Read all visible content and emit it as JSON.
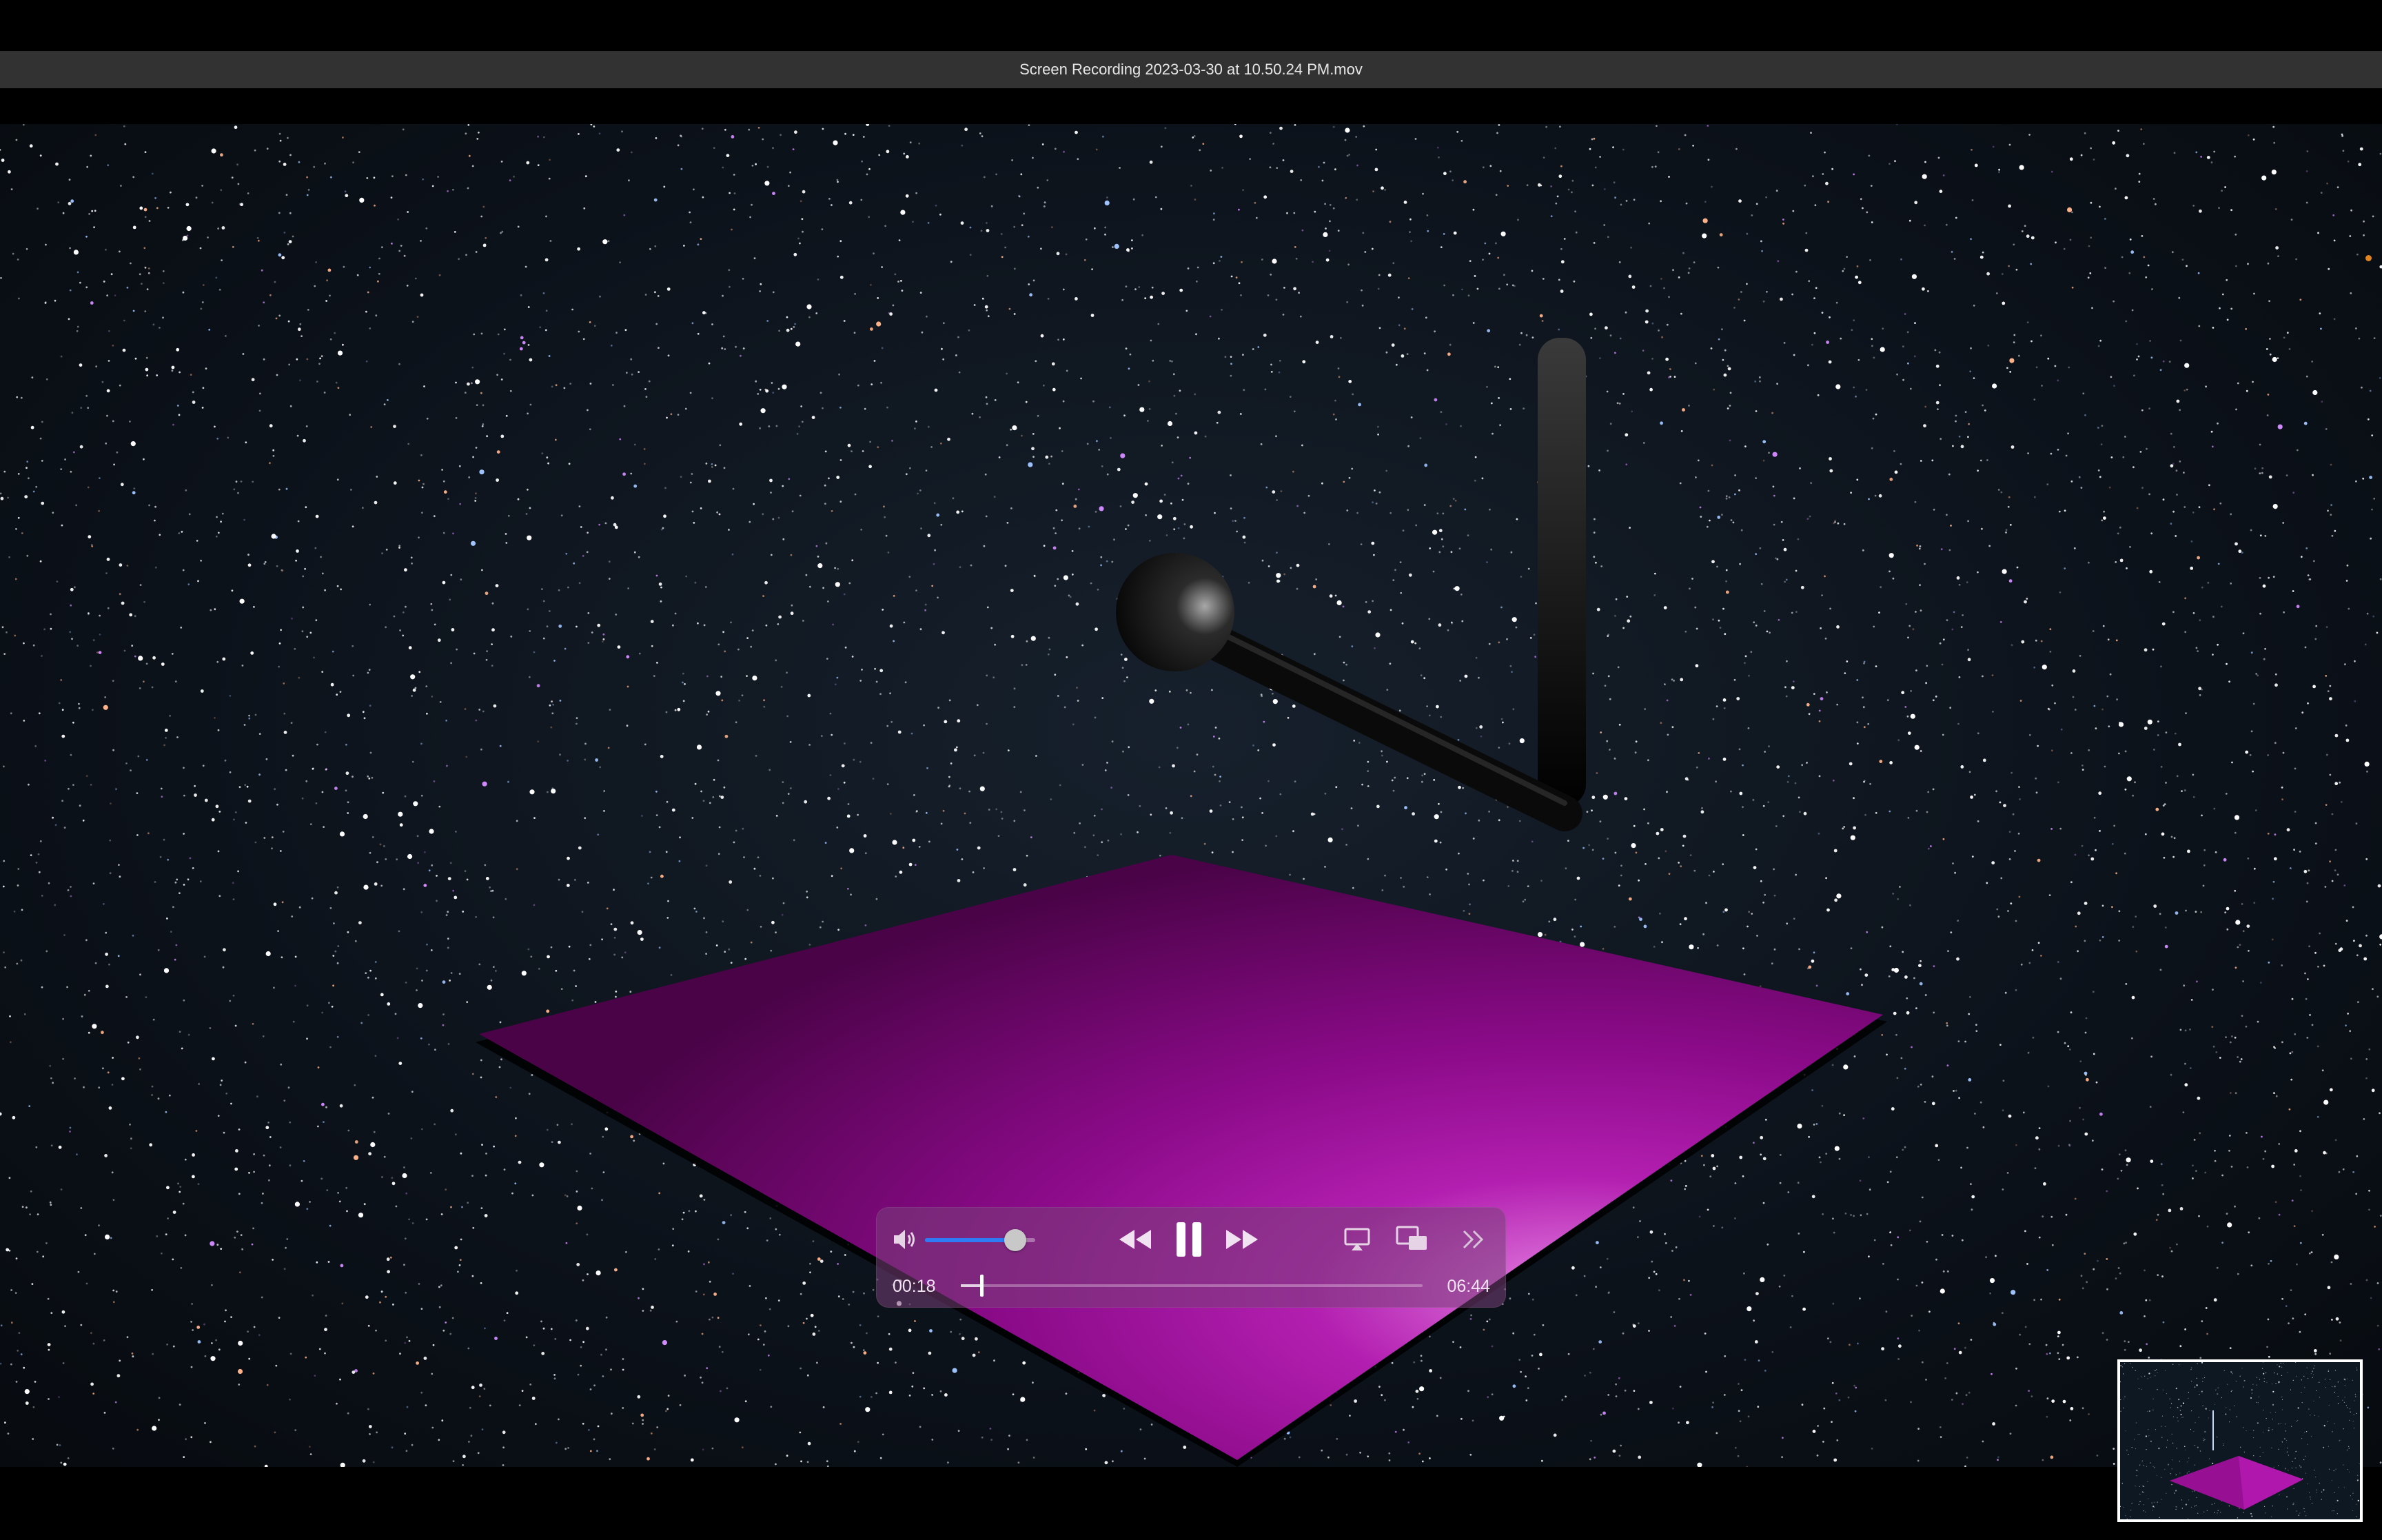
{
  "window": {
    "title": "Screen Recording 2023-03-30 at 10.50.24 PM.mov"
  },
  "player": {
    "volume_level": 0.82,
    "current_time": "00:18",
    "duration": "06:44",
    "progress": 0.045,
    "state": "playing"
  },
  "icons": {
    "volume": "speaker-icon",
    "rewind": "rewind-icon",
    "pause": "pause-icon",
    "fast_forward": "fast-forward-icon",
    "airplay": "airplay-icon",
    "pip": "picture-in-picture-icon",
    "more": "chevron-double-right-icon"
  },
  "colors": {
    "accent": "#2f7bf5",
    "plane": "#a0109c",
    "sky": "#0c121a"
  }
}
